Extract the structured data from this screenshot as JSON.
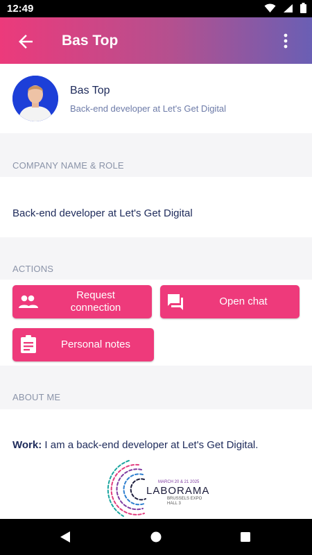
{
  "status_bar": {
    "time": "12:49",
    "icons": [
      "wifi-icon",
      "signal-icon",
      "battery-icon"
    ]
  },
  "app_bar": {
    "title": "Bas Top",
    "back_icon": "arrow-back-icon",
    "menu_icon": "more-vertical-icon"
  },
  "profile": {
    "name": "Bas Top",
    "subtitle": "Back-end developer at Let's Get Digital"
  },
  "company": {
    "label": "COMPANY NAME & ROLE",
    "value": "Back-end developer at Let's Get Digital"
  },
  "actions": {
    "label": "ACTIONS",
    "buttons": [
      {
        "label_line1": "Request",
        "label_line2": "connection",
        "icon": "people-icon"
      },
      {
        "label": "Open chat",
        "icon": "chat-icon"
      },
      {
        "label": "Personal notes",
        "icon": "clipboard-icon"
      }
    ]
  },
  "about": {
    "label": "ABOUT ME",
    "work_label": "Work:",
    "work_text": " I am a back-end developer at Let's Get Digital."
  },
  "banner": {
    "date": "MARCH 20 & 21 2025",
    "brand": "LABORAMA",
    "venue_line1": "BRUSSELS EXPO",
    "venue_line2": "HALL 3"
  },
  "colors": {
    "accent": "#ee3a7b",
    "gradient_end": "#6a5fb4",
    "text_dark": "#1d2a5a",
    "label_grey": "#8a93a8"
  }
}
